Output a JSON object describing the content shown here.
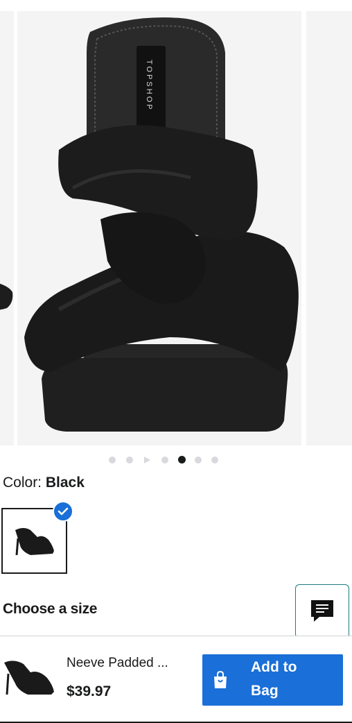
{
  "gallery": {
    "brand_label": "TOPSHOP",
    "dots_total": 7,
    "active_dot_index": 4
  },
  "color": {
    "label": "Color:",
    "value": "Black"
  },
  "size": {
    "title": "Choose a size"
  },
  "chat": {
    "icon": "chat-icon"
  },
  "bottom_bar": {
    "product_name": "Neeve Padded ...",
    "price": "$39.97",
    "add_button_line1": "Add to",
    "add_button_line2": "Bag",
    "bag_icon": "shopping-bag-icon"
  },
  "colors": {
    "accent": "#1a6fd8",
    "text": "#191a1b",
    "chat_border": "#1f7a84"
  }
}
